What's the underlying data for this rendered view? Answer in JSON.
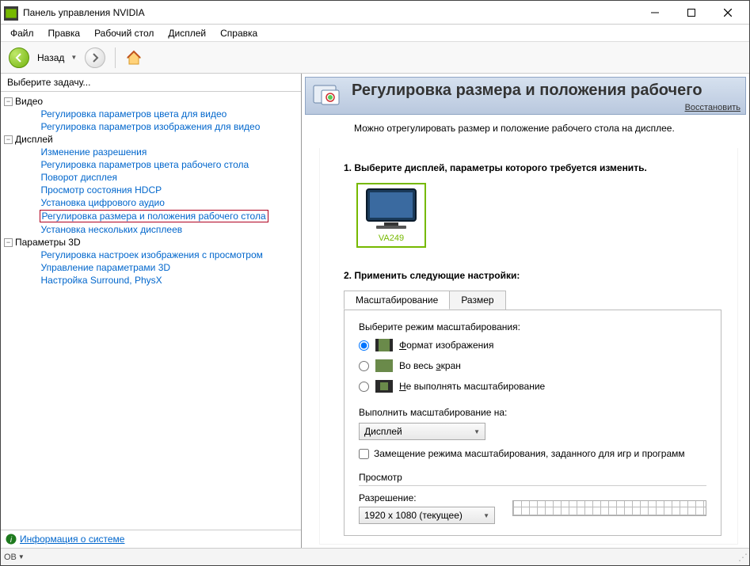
{
  "titlebar": {
    "title": "Панель управления NVIDIA"
  },
  "menu": {
    "items": [
      "Файл",
      "Правка",
      "Рабочий стол",
      "Дисплей",
      "Справка"
    ]
  },
  "toolbar": {
    "back_label": "Назад"
  },
  "left": {
    "task_header": "Выберите задачу...",
    "groups": [
      {
        "label": "Видео",
        "items": [
          "Регулировка параметров цвета для видео",
          "Регулировка параметров изображения для видео"
        ]
      },
      {
        "label": "Дисплей",
        "items": [
          "Изменение разрешения",
          "Регулировка параметров цвета рабочего стола",
          "Поворот дисплея",
          "Просмотр состояния HDCP",
          "Установка цифрового аудио",
          "Регулировка размера и положения рабочего стола",
          "Установка нескольких дисплеев"
        ],
        "selected_index": 5
      },
      {
        "label": "Параметры 3D",
        "items": [
          "Регулировка настроек изображения с просмотром",
          "Управление параметрами 3D",
          "Настройка Surround, PhysX"
        ]
      }
    ],
    "footer_link": "Информация о системе"
  },
  "right": {
    "title": "Регулировка размера и положения рабочего",
    "restore": "Восстановить",
    "description": "Можно отрегулировать размер и положение рабочего стола на дисплее.",
    "step1_title": "1. Выберите дисплей, параметры которого требуется изменить.",
    "display_name": "VA249",
    "step2_title": "2. Применить следующие настройки:",
    "tabs": {
      "tab1": "Масштабирование",
      "tab2": "Размер"
    },
    "scaling_mode_label": "Выберите режим масштабирования:",
    "scaling_options": [
      {
        "label_pre": "Ф",
        "label_rest": "ормат изображения"
      },
      {
        "label_pre": "",
        "label_rest": "Во весь экран",
        "underline_word": "э"
      },
      {
        "label_pre": "Н",
        "label_rest": "е выполнять масштабирование"
      }
    ],
    "perform_on_label": "Выполнить масштабирование на:",
    "perform_on_value": "Дисплей",
    "override_label": "Замещение режима масштабирования, заданного для игр и программ",
    "preview_label": "Просмотр",
    "resolution_label": "Разрешение:",
    "resolution_value": "1920 x 1080 (текущее)"
  },
  "status": {
    "left_text": "ОВ"
  }
}
